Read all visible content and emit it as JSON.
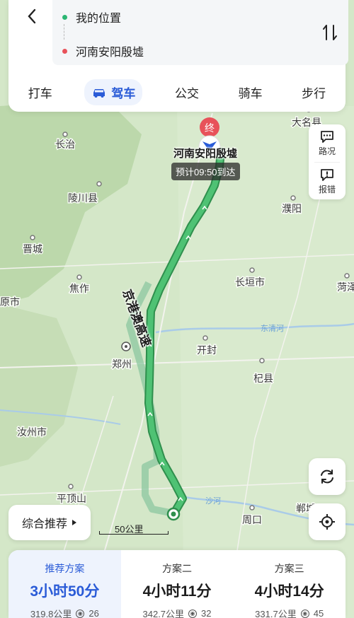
{
  "header": {
    "from": "我的位置",
    "to": "河南安阳殷墟",
    "modes": [
      "打车",
      "驾车",
      "公交",
      "骑车",
      "步行"
    ],
    "active_mode": "驾车"
  },
  "side_buttons": {
    "traffic": "路况",
    "report": "报错"
  },
  "map": {
    "cities": [
      "长治",
      "大名县",
      "陵川县",
      "濮阳",
      "晋城",
      "焦作",
      "长垣市",
      "菏泽",
      "原市",
      "开封",
      "郑州",
      "杞县",
      "汝州市",
      "平顶山",
      "周口",
      "郸城"
    ],
    "rivers": [
      "东清河",
      "沙河"
    ],
    "destination": "河南安阳殷墟",
    "destination_marker": "终",
    "eta": "预计09:50到达",
    "road": "京港澳高速"
  },
  "chip": {
    "label": "综合推荐"
  },
  "scale": {
    "label": "50公里"
  },
  "plans": [
    {
      "name": "推荐方案",
      "time": "3小时50分",
      "distance": "319.8公里",
      "lights": "26"
    },
    {
      "name": "方案二",
      "time": "4小时11分",
      "distance": "342.7公里",
      "lights": "32"
    },
    {
      "name": "方案三",
      "time": "4小时14分",
      "distance": "331.7公里",
      "lights": "45"
    }
  ],
  "colors": {
    "route": "#3cae5f",
    "accent": "#2a5bd7",
    "destination": "#e8525a"
  }
}
